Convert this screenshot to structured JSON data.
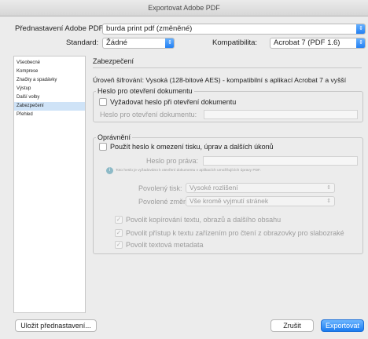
{
  "window": {
    "title": "Exportovat Adobe PDF"
  },
  "preset": {
    "label": "Přednastavení Adobe PDF:",
    "value": "burda print pdf (změněné)"
  },
  "standard": {
    "label": "Standard:",
    "value": "Žádné"
  },
  "compat": {
    "label": "Kompatibilita:",
    "value": "Acrobat 7 (PDF 1.6)"
  },
  "sidebar": {
    "items": [
      {
        "label": "Všeobecné"
      },
      {
        "label": "Komprese"
      },
      {
        "label": "Značky a spadávky"
      },
      {
        "label": "Výstup"
      },
      {
        "label": "Další volby"
      },
      {
        "label": "Zabezpečení"
      },
      {
        "label": "Přehled"
      }
    ]
  },
  "panel": {
    "title": "Zabezpečení",
    "encryption": "Úroveň šifrování: Vysoká (128-bitové AES) - kompatibilní s aplikací Acrobat 7 a vyšší",
    "open_password": {
      "legend": "Heslo pro otevření dokumentu",
      "require_label": "Vyžadovat heslo při otevření dokumentu",
      "field_label": "Heslo pro otevření dokumentu:"
    },
    "permissions": {
      "legend": "Oprávnění",
      "use_password_label": "Použít heslo k omezení tisku, úprav a dalších úkonů",
      "password_label": "Heslo pro práva:",
      "note": "Toto heslo je vyžadováno k otevření dokumentu v aplikacích umožňujících úpravy PDF.",
      "printing_label": "Povolený tisk:",
      "printing_value": "Vysoké rozlišení",
      "changes_label": "Povolené změny:",
      "changes_value": "Vše kromě vyjmutí stránek",
      "copy_label": "Povolit kopírování textu, obrazů a dalšího obsahu",
      "access_label": "Povolit přístup k textu zařízením pro čtení z obrazovky pro slabozraké",
      "metadata_label": "Povolit textová metadata"
    }
  },
  "footer": {
    "save_preset_label": "Uložit přednastavení...",
    "cancel_label": "Zrušit",
    "export_label": "Exportovat"
  }
}
